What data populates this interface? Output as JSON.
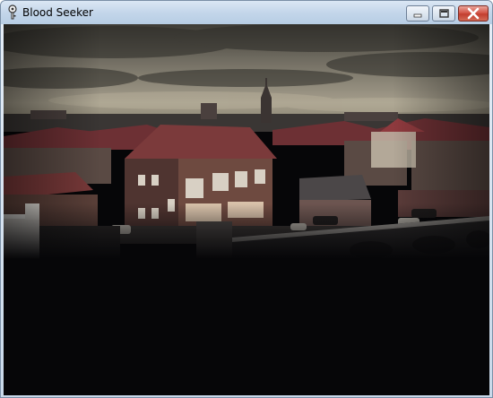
{
  "window": {
    "title": "Blood Seeker",
    "icons": {
      "app": "key-icon",
      "minimize": "minimize-icon",
      "maximize": "maximize-icon",
      "close": "close-icon"
    },
    "close_color": "#c94a3a"
  },
  "content": {
    "image": "city-rooftops-panorama",
    "sky_color": "#8a8577",
    "roof_color": "#7a3a3a",
    "background_color": "#060608"
  }
}
